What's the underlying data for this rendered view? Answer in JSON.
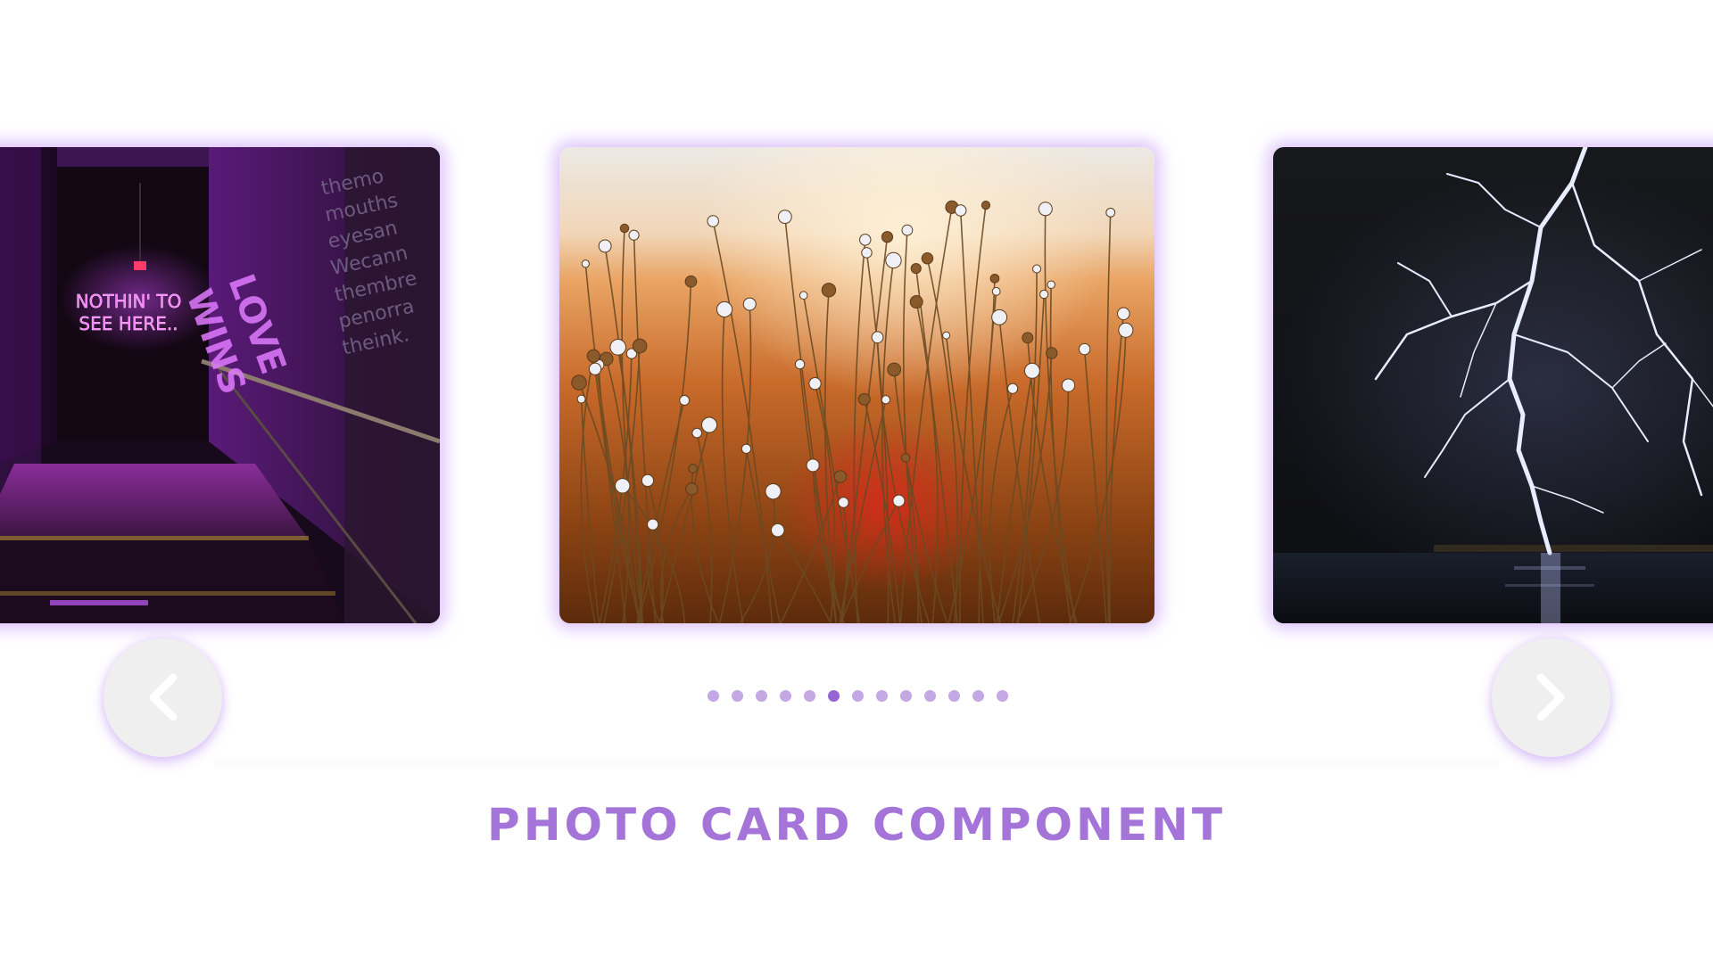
{
  "carousel": {
    "cards": [
      {
        "id": "card-left",
        "description_icon": "neon-corridor-photo",
        "neon_sign_text": [
          "NOTHIN' TO",
          "SEE HERE.."
        ],
        "wall_text": [
          "themo",
          "mouths",
          "eyesan",
          "Wecann",
          "thembre",
          "penorra",
          "theink."
        ],
        "wall_text_large": [
          "LOVE",
          "WINS"
        ]
      },
      {
        "id": "card-center",
        "description_icon": "wildflower-field-photo"
      },
      {
        "id": "card-right",
        "description_icon": "lightning-storm-photo"
      }
    ],
    "prev_icon": "chevron-left-icon",
    "next_icon": "chevron-right-icon",
    "dots_total": 13,
    "active_dot": 6
  },
  "colors": {
    "accent": "#a574d9",
    "dot": "#c3a8e3",
    "dot_active": "#9466d4",
    "glow": "#be8cf5",
    "button_bg": "#efefef"
  },
  "title": "PHOTO CARD COMPONENT"
}
